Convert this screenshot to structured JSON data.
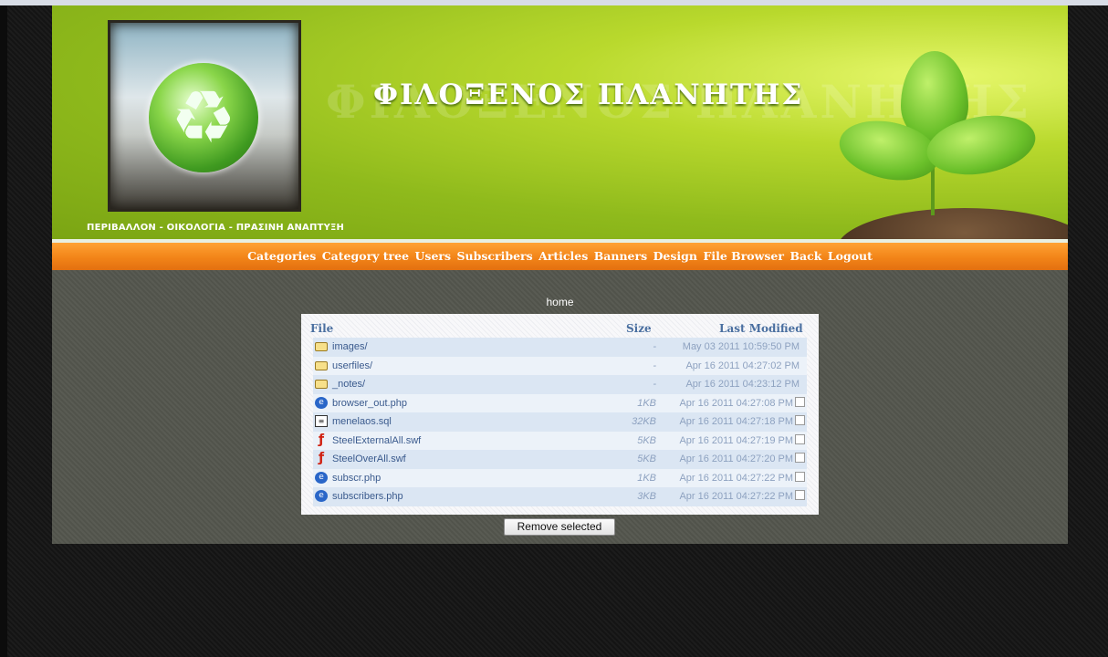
{
  "site": {
    "title": "ΦΙΛΟΞΕΝΟΣ ΠΛΑΝΗΤΗΣ",
    "tagline": "ΠΕΡΙΒΑΛΛΟΝ - ΟΙΚΟΛΟΓΙΑ - ΠΡΑΣΙΝΗ ΑΝΑΠΤΥΞΗ"
  },
  "nav": {
    "items": [
      "Categories",
      "Category tree",
      "Users",
      "Subscribers",
      "Articles",
      "Banners",
      "Design",
      "File Browser",
      "Back",
      "Logout"
    ]
  },
  "browser": {
    "path": "home",
    "columns": {
      "file": "File",
      "size": "Size",
      "modified": "Last Modified"
    },
    "files": [
      {
        "name": "images/",
        "size": "-",
        "modified": "May 03 2011 10:59:50 PM",
        "icon": "folder-icon",
        "selectable": false
      },
      {
        "name": "userfiles/",
        "size": "-",
        "modified": "Apr 16 2011 04:27:02 PM",
        "icon": "folder-icon",
        "selectable": false
      },
      {
        "name": "_notes/",
        "size": "-",
        "modified": "Apr 16 2011 04:23:12 PM",
        "icon": "folder-icon",
        "selectable": false
      },
      {
        "name": "browser_out.php",
        "size": "1KB",
        "modified": "Apr 16 2011 04:27:08 PM",
        "icon": "php-file-icon",
        "selectable": true
      },
      {
        "name": "menelaos.sql",
        "size": "32KB",
        "modified": "Apr 16 2011 04:27:18 PM",
        "icon": "sql-file-icon",
        "selectable": true
      },
      {
        "name": "SteelExternalAll.swf",
        "size": "5KB",
        "modified": "Apr 16 2011 04:27:19 PM",
        "icon": "flash-file-icon",
        "selectable": true
      },
      {
        "name": "SteelOverAll.swf",
        "size": "5KB",
        "modified": "Apr 16 2011 04:27:20 PM",
        "icon": "flash-file-icon",
        "selectable": true
      },
      {
        "name": "subscr.php",
        "size": "1KB",
        "modified": "Apr 16 2011 04:27:22 PM",
        "icon": "php-file-icon",
        "selectable": true
      },
      {
        "name": "subscribers.php",
        "size": "3KB",
        "modified": "Apr 16 2011 04:27:22 PM",
        "icon": "php-file-icon",
        "selectable": true
      }
    ],
    "remove_label": "Remove selected"
  }
}
